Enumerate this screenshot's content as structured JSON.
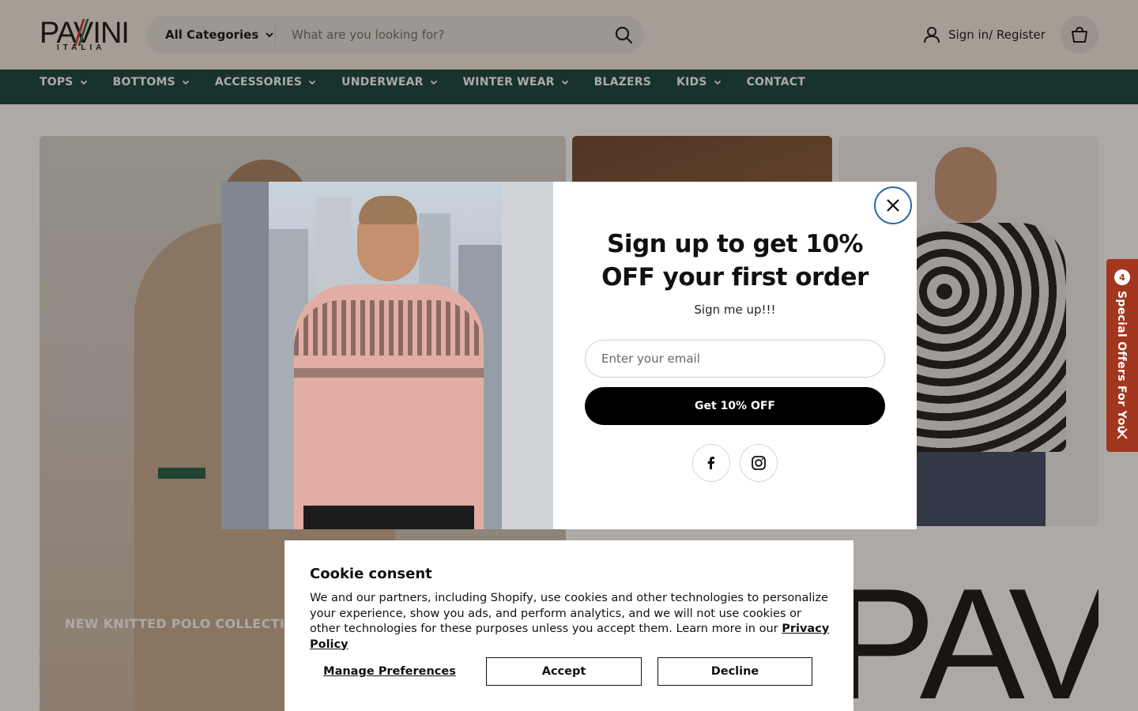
{
  "brand": {
    "logo_text": "PAVINI",
    "logo_sub": "ITALIA",
    "stripe_colors": [
      "#d12a2a",
      "#1f6b45",
      "#111111"
    ]
  },
  "header": {
    "category_select": "All Categories",
    "search_placeholder": "What are you looking for?",
    "signin_label": "Sign in/ Register",
    "icons": {
      "search": "search-icon",
      "user": "user-icon",
      "cart": "shopping-bag-icon",
      "chevron": "chevron-down-icon"
    }
  },
  "nav": {
    "items": [
      {
        "label": "TOPS",
        "has_dropdown": true
      },
      {
        "label": "BOTTOMS",
        "has_dropdown": true
      },
      {
        "label": "ACCESSORIES",
        "has_dropdown": true
      },
      {
        "label": "UNDERWEAR",
        "has_dropdown": true
      },
      {
        "label": "WINTER WEAR",
        "has_dropdown": true
      },
      {
        "label": "BLAZERS",
        "has_dropdown": false
      },
      {
        "label": "KIDS",
        "has_dropdown": true
      },
      {
        "label": "CONTACT",
        "has_dropdown": false
      }
    ]
  },
  "hero": {
    "left_caption": "NEW KNITTED POLO COLLECTION",
    "brand_mark": "PAVINI"
  },
  "offers_tab": {
    "badge": "4",
    "label": "Special Offers For You"
  },
  "signup_modal": {
    "title": "Sign up to get 10% OFF your first order",
    "subtitle": "Sign me up!!!",
    "email_placeholder": "Enter your email",
    "submit_label": "Get 10% OFF",
    "social": [
      "facebook-icon",
      "instagram-icon"
    ]
  },
  "cookie_consent": {
    "title": "Cookie consent",
    "body": "We and our partners, including Shopify, use cookies and other technologies to personalize your experience, show you ads, and perform analytics, and we will not use cookies or other technologies for these purposes unless you accept them. Learn more in our ",
    "link_label": "Privacy Policy",
    "manage_label": "Manage Preferences",
    "accept_label": "Accept",
    "decline_label": "Decline"
  },
  "colors": {
    "header_bg": "#f4ece4",
    "nav_bg": "#0f3f3c",
    "offers_tab_bg": "#a2361f",
    "close_ring": "#2c6aa8",
    "cta_bg": "#000000"
  }
}
